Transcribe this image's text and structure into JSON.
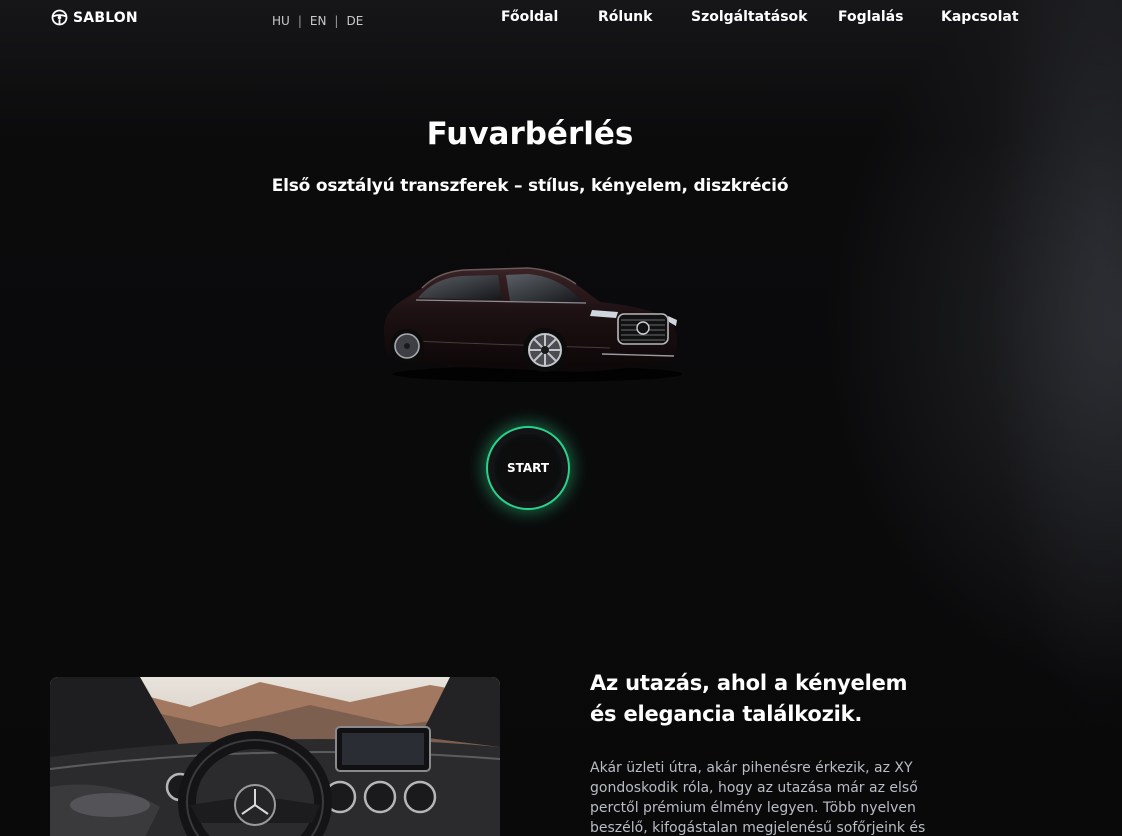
{
  "header": {
    "logo_text": "SABLON",
    "logo_icon": "steering-wheel-icon",
    "languages": [
      "HU",
      "EN",
      "DE"
    ],
    "nav": [
      "Főoldal",
      "Rólunk",
      "Szolgáltatások",
      "Foglalás",
      "Kapcsolat"
    ]
  },
  "hero": {
    "title": "Fuvarbérlés",
    "subtitle": "Első osztályú transzferek – stílus, kényelem, diszkréció",
    "start_label": "START"
  },
  "about": {
    "title_line1": "Az utazás, ahol a kényelem",
    "title_line2": "és elegancia találkozik.",
    "text": "Akár üzleti útra, akár pihenésre érkezik, az XY gondoskodik róla, hogy az utazása már az első perctől prémium élmény legyen. Több nyelven beszélő, kifogástalan megjelenésű sofőrjeink és"
  },
  "colors": {
    "background": "#0a0a0b",
    "accent": "#2bd18a",
    "body_text": "#b9bcc4"
  }
}
